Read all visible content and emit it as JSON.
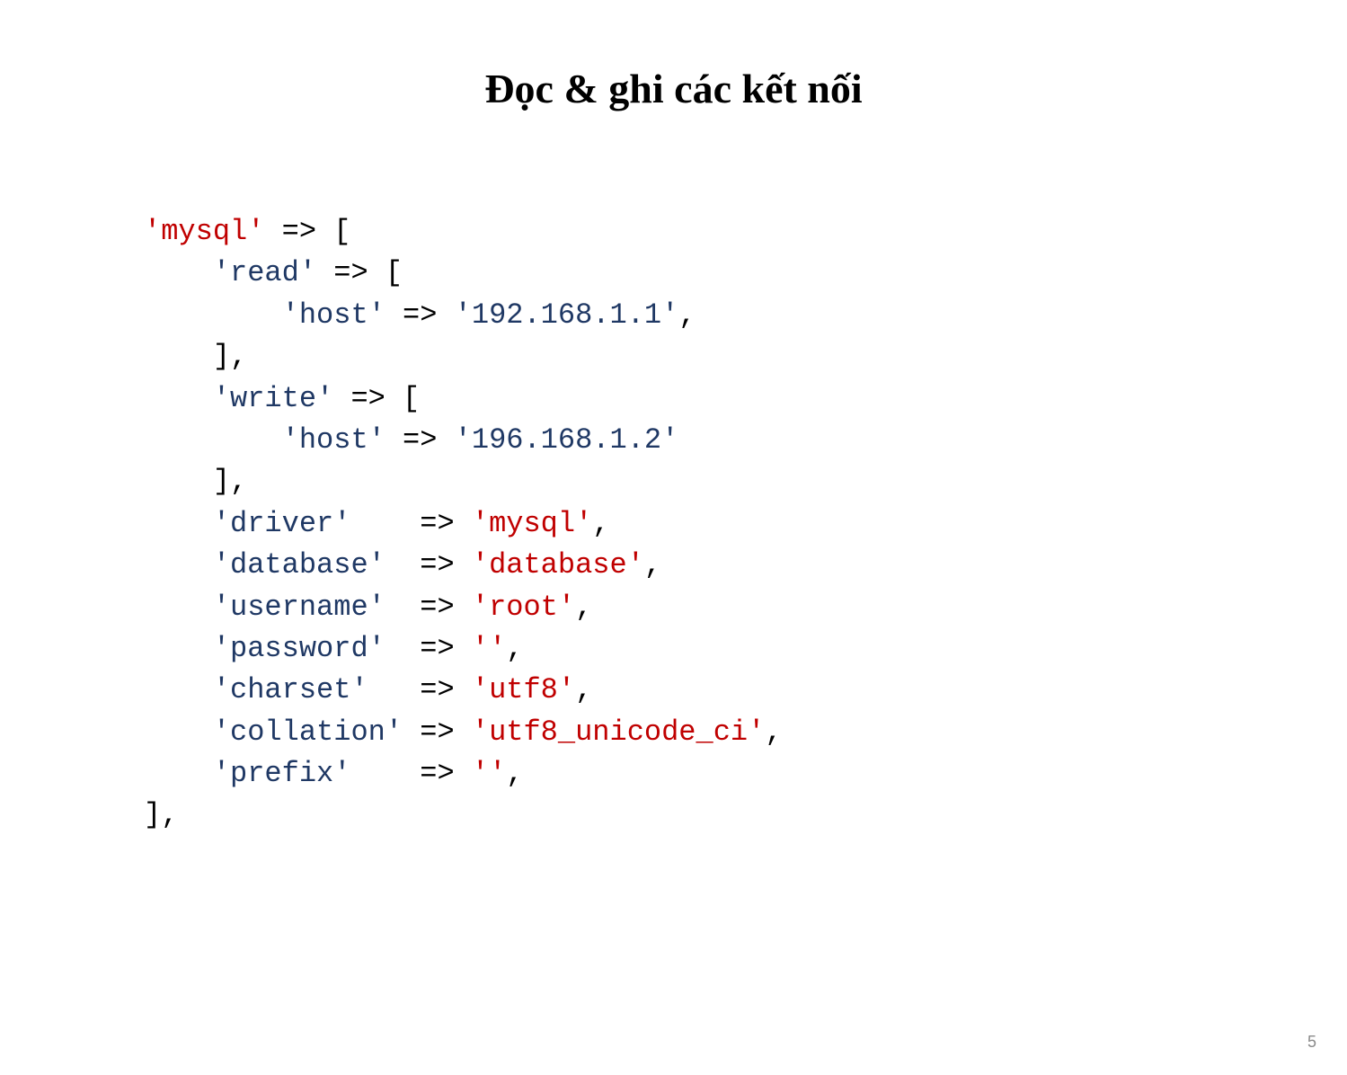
{
  "title": "Đọc & ghi các kết nối",
  "page_number": "5",
  "code": {
    "l1_key": "'mysql'",
    "l1_rest": " => [",
    "l2_key": "'read'",
    "l2_rest": " => [",
    "l3_key": "'host'",
    "l3_mid": " => ",
    "l3_val": "'192.168.1.1'",
    "l3_end": ",",
    "l4": "    ],",
    "l5_key": "'write'",
    "l5_rest": " => [",
    "l6_key": "'host'",
    "l6_mid": " => ",
    "l6_val": "'196.168.1.2'",
    "l7": "    ],",
    "l8_key": "'driver'",
    "l8_mid": "    => ",
    "l8_val": "'mysql'",
    "l8_end": ",",
    "l9_key": "'database'",
    "l9_mid": "  => ",
    "l9_val": "'database'",
    "l9_end": ",",
    "l10_key": "'username'",
    "l10_mid": "  => ",
    "l10_val": "'root'",
    "l10_end": ",",
    "l11_key": "'password'",
    "l11_mid": "  => ",
    "l11_val": "''",
    "l11_end": ",",
    "l12_key": "'charset'",
    "l12_mid": "   => ",
    "l12_val": "'utf8'",
    "l12_end": ",",
    "l13_key": "'collation'",
    "l13_mid": " => ",
    "l13_val": "'utf8_unicode_ci'",
    "l13_end": ",",
    "l14_key": "'prefix'",
    "l14_mid": "    => ",
    "l14_val": "''",
    "l14_end": ",",
    "l15": "],"
  }
}
